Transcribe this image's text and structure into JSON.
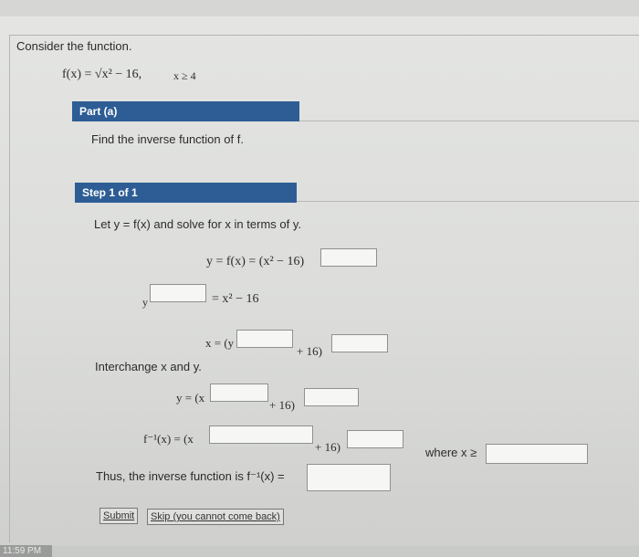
{
  "problem": {
    "intro": "Consider the function.",
    "function_def": "f(x) = √x² − 16,",
    "domain": "x ≥ 4"
  },
  "part": {
    "label": "Part (a)",
    "instruction": "Find the inverse function of f."
  },
  "step": {
    "label": "Step 1 of 1",
    "instruction": "Let y = f(x) and solve for x in terms of y.",
    "eq1": "y = f(x) = (x² − 16)",
    "eq2_left": "y",
    "eq2_right": "= x² − 16",
    "eq3_left": "x = (y",
    "eq3_plus": "+ 16)",
    "interchange": "Interchange x and y.",
    "eq4_left": "y = (x",
    "eq4_plus": "+ 16)",
    "eq5_left": "f⁻¹(x) = (x",
    "eq5_plus": "+ 16)",
    "where_label": "where x ≥",
    "thus": "Thus, the inverse function is  f⁻¹(x) ="
  },
  "inputs": {
    "eq1_exp": "",
    "eq2_exp": "",
    "eq3_inner_exp": "",
    "eq3_outer_exp": "",
    "eq4_inner_exp": "",
    "eq4_outer_exp": "",
    "eq5_inner_exp": "",
    "eq5_outer_exp": "",
    "where_value": "",
    "final_answer": ""
  },
  "buttons": {
    "submit": "Submit",
    "skip": "Skip (you cannot come back)"
  },
  "taskbar": {
    "time": "11:59 PM"
  },
  "colors": {
    "header_bar": "#2d5d94",
    "background": "#e4e5e3"
  }
}
